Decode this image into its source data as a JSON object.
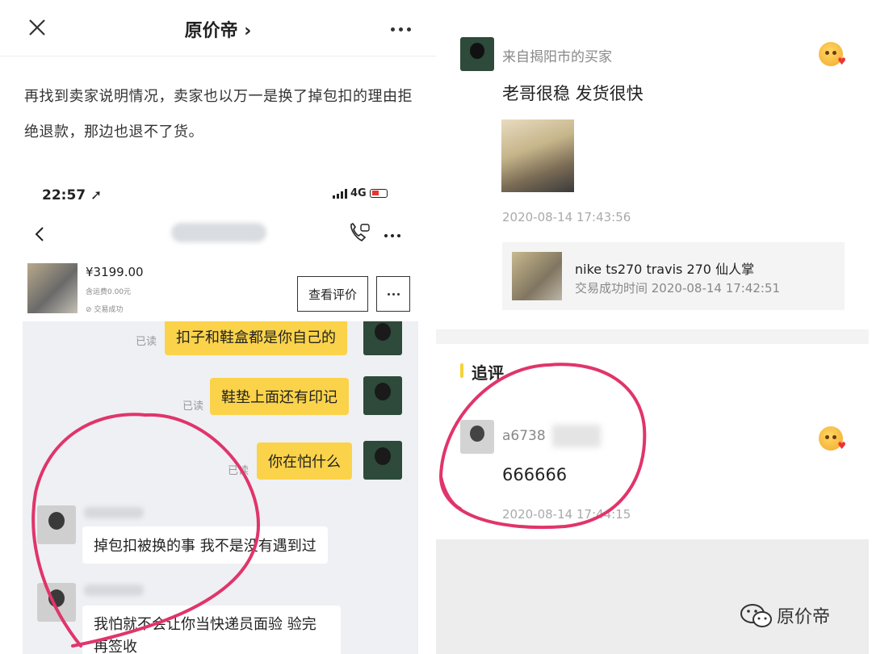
{
  "left": {
    "topbar": {
      "title": "原价帝 ›"
    },
    "article_text": "再找到卖家说明情况，卖家也以万一是换了掉包扣的理由拒绝退款，那边也退不了货。",
    "status": {
      "time": "22:57 ➚",
      "network": "4G"
    },
    "product": {
      "price": "¥3199.00",
      "shipping": "含运费0.00元",
      "deal_status": "交易成功"
    },
    "review_button": "查看评价",
    "messages": [
      {
        "text": "扣子和鞋盒都是你自己的",
        "read": "已读"
      },
      {
        "text": "鞋垫上面还有印记",
        "read": "已读"
      },
      {
        "text": "你在怕什么",
        "read": "已读"
      },
      {
        "text": "掉包扣被换的事 我不是没有遇到过"
      },
      {
        "text": "我怕就不会让你当快递员面验 验完再签收"
      }
    ]
  },
  "right": {
    "review": {
      "buyer": "来自揭阳市的买家",
      "text": "老哥很稳 发货很快",
      "time": "2020-08-14 17:43:56",
      "product_name": "nike ts270 travis 270 仙人掌",
      "deal_time": "交易成功时间 2020-08-14 17:42:51"
    },
    "follow_label": "追评",
    "follow": {
      "user": "a6738",
      "text": "666666",
      "time": "2020-08-14 17:44:15"
    },
    "watermark": "原价帝"
  },
  "colors": {
    "bubble": "#fbd34a",
    "circle": "#e0356a",
    "chat_bg": "#eef0f4"
  }
}
